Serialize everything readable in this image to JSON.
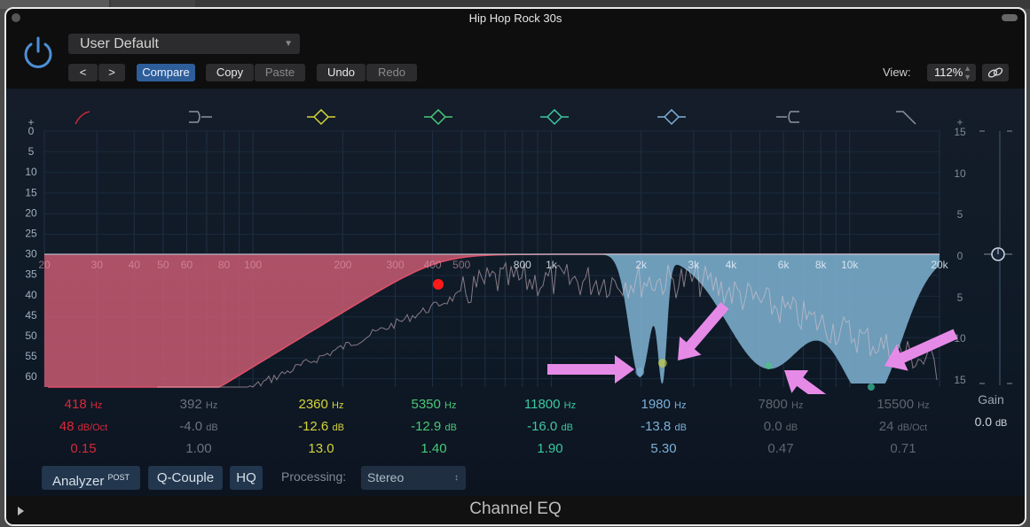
{
  "window": {
    "title": "Hip Hop Rock 30s"
  },
  "toolbar": {
    "preset": "User Default",
    "prev_label": "<",
    "next_label": ">",
    "compare_label": "Compare",
    "copy_label": "Copy",
    "paste_label": "Paste",
    "undo_label": "Undo",
    "redo_label": "Redo",
    "view_label": "View:",
    "view_value": "112%",
    "power_icon": "power-icon",
    "link_icon": "link-icon"
  },
  "band_icons": [
    {
      "type": "low-cut",
      "color": "#c8283c",
      "state": "on"
    },
    {
      "type": "low-shelf",
      "color": "#8a939c",
      "state": "off"
    },
    {
      "type": "bell",
      "color": "#d4d43a",
      "state": "on"
    },
    {
      "type": "bell",
      "color": "#48c878",
      "state": "on"
    },
    {
      "type": "bell",
      "color": "#3cc8a0",
      "state": "on"
    },
    {
      "type": "bell",
      "color": "#7cb0d8",
      "state": "on"
    },
    {
      "type": "high-shelf",
      "color": "#8a939c",
      "state": "off"
    },
    {
      "type": "high-cut",
      "color": "#8a939c",
      "state": "off"
    }
  ],
  "left_scale": [
    "+",
    "0",
    "5",
    "10",
    "15",
    "20",
    "25",
    "30",
    "35",
    "40",
    "45",
    "50",
    "55",
    "60"
  ],
  "right_scale": [
    "+",
    "15",
    "10",
    "5",
    "0",
    "5",
    "10",
    "15"
  ],
  "freq_labels": [
    "20",
    "30",
    "40",
    "50",
    "60",
    "80",
    "100",
    "200",
    "300",
    "400",
    "500",
    "800",
    "1k",
    "2k",
    "3k",
    "4k",
    "6k",
    "8k",
    "10k",
    "20k"
  ],
  "bands": [
    {
      "freq": "418",
      "freq_unit": "Hz",
      "gain": "48",
      "gain_unit": "dB/Oct",
      "q": "0.15",
      "color": "#d8283a"
    },
    {
      "freq": "392",
      "freq_unit": "Hz",
      "gain": "-4.0",
      "gain_unit": "dB",
      "q": "1.00",
      "color": "#6b737c"
    },
    {
      "freq": "2360",
      "freq_unit": "Hz",
      "gain": "-12.6",
      "gain_unit": "dB",
      "q": "13.0",
      "color": "#d4d43a"
    },
    {
      "freq": "5350",
      "freq_unit": "Hz",
      "gain": "-12.9",
      "gain_unit": "dB",
      "q": "1.40",
      "color": "#48c878"
    },
    {
      "freq": "11800",
      "freq_unit": "Hz",
      "gain": "-16.0",
      "gain_unit": "dB",
      "q": "1.90",
      "color": "#3cc8a0"
    },
    {
      "freq": "1980",
      "freq_unit": "Hz",
      "gain": "-13.8",
      "gain_unit": "dB",
      "q": "5.30",
      "color": "#7cb0d8"
    },
    {
      "freq": "7800",
      "freq_unit": "Hz",
      "gain": "0.0",
      "gain_unit": "dB",
      "q": "0.47",
      "color": "#5d656e"
    },
    {
      "freq": "15500",
      "freq_unit": "Hz",
      "gain": "24",
      "gain_unit": "dB/Oct",
      "q": "0.71",
      "color": "#5d656e"
    }
  ],
  "gain": {
    "label": "Gain",
    "value": "0.0",
    "unit": "dB"
  },
  "bottom": {
    "analyzer_label": "Analyzer",
    "analyzer_badge": "POST",
    "qcouple_label": "Q-Couple",
    "hq_label": "HQ",
    "processing_label": "Processing:",
    "processing_value": "Stereo"
  },
  "footer": {
    "plugin_name": "Channel EQ"
  },
  "colors": {
    "accent_blue": "#2e5e9a",
    "lowcut_fill": "#c85a72",
    "notch_fill": "#7fb4d4",
    "annotation_arrow": "#e68ae8"
  }
}
